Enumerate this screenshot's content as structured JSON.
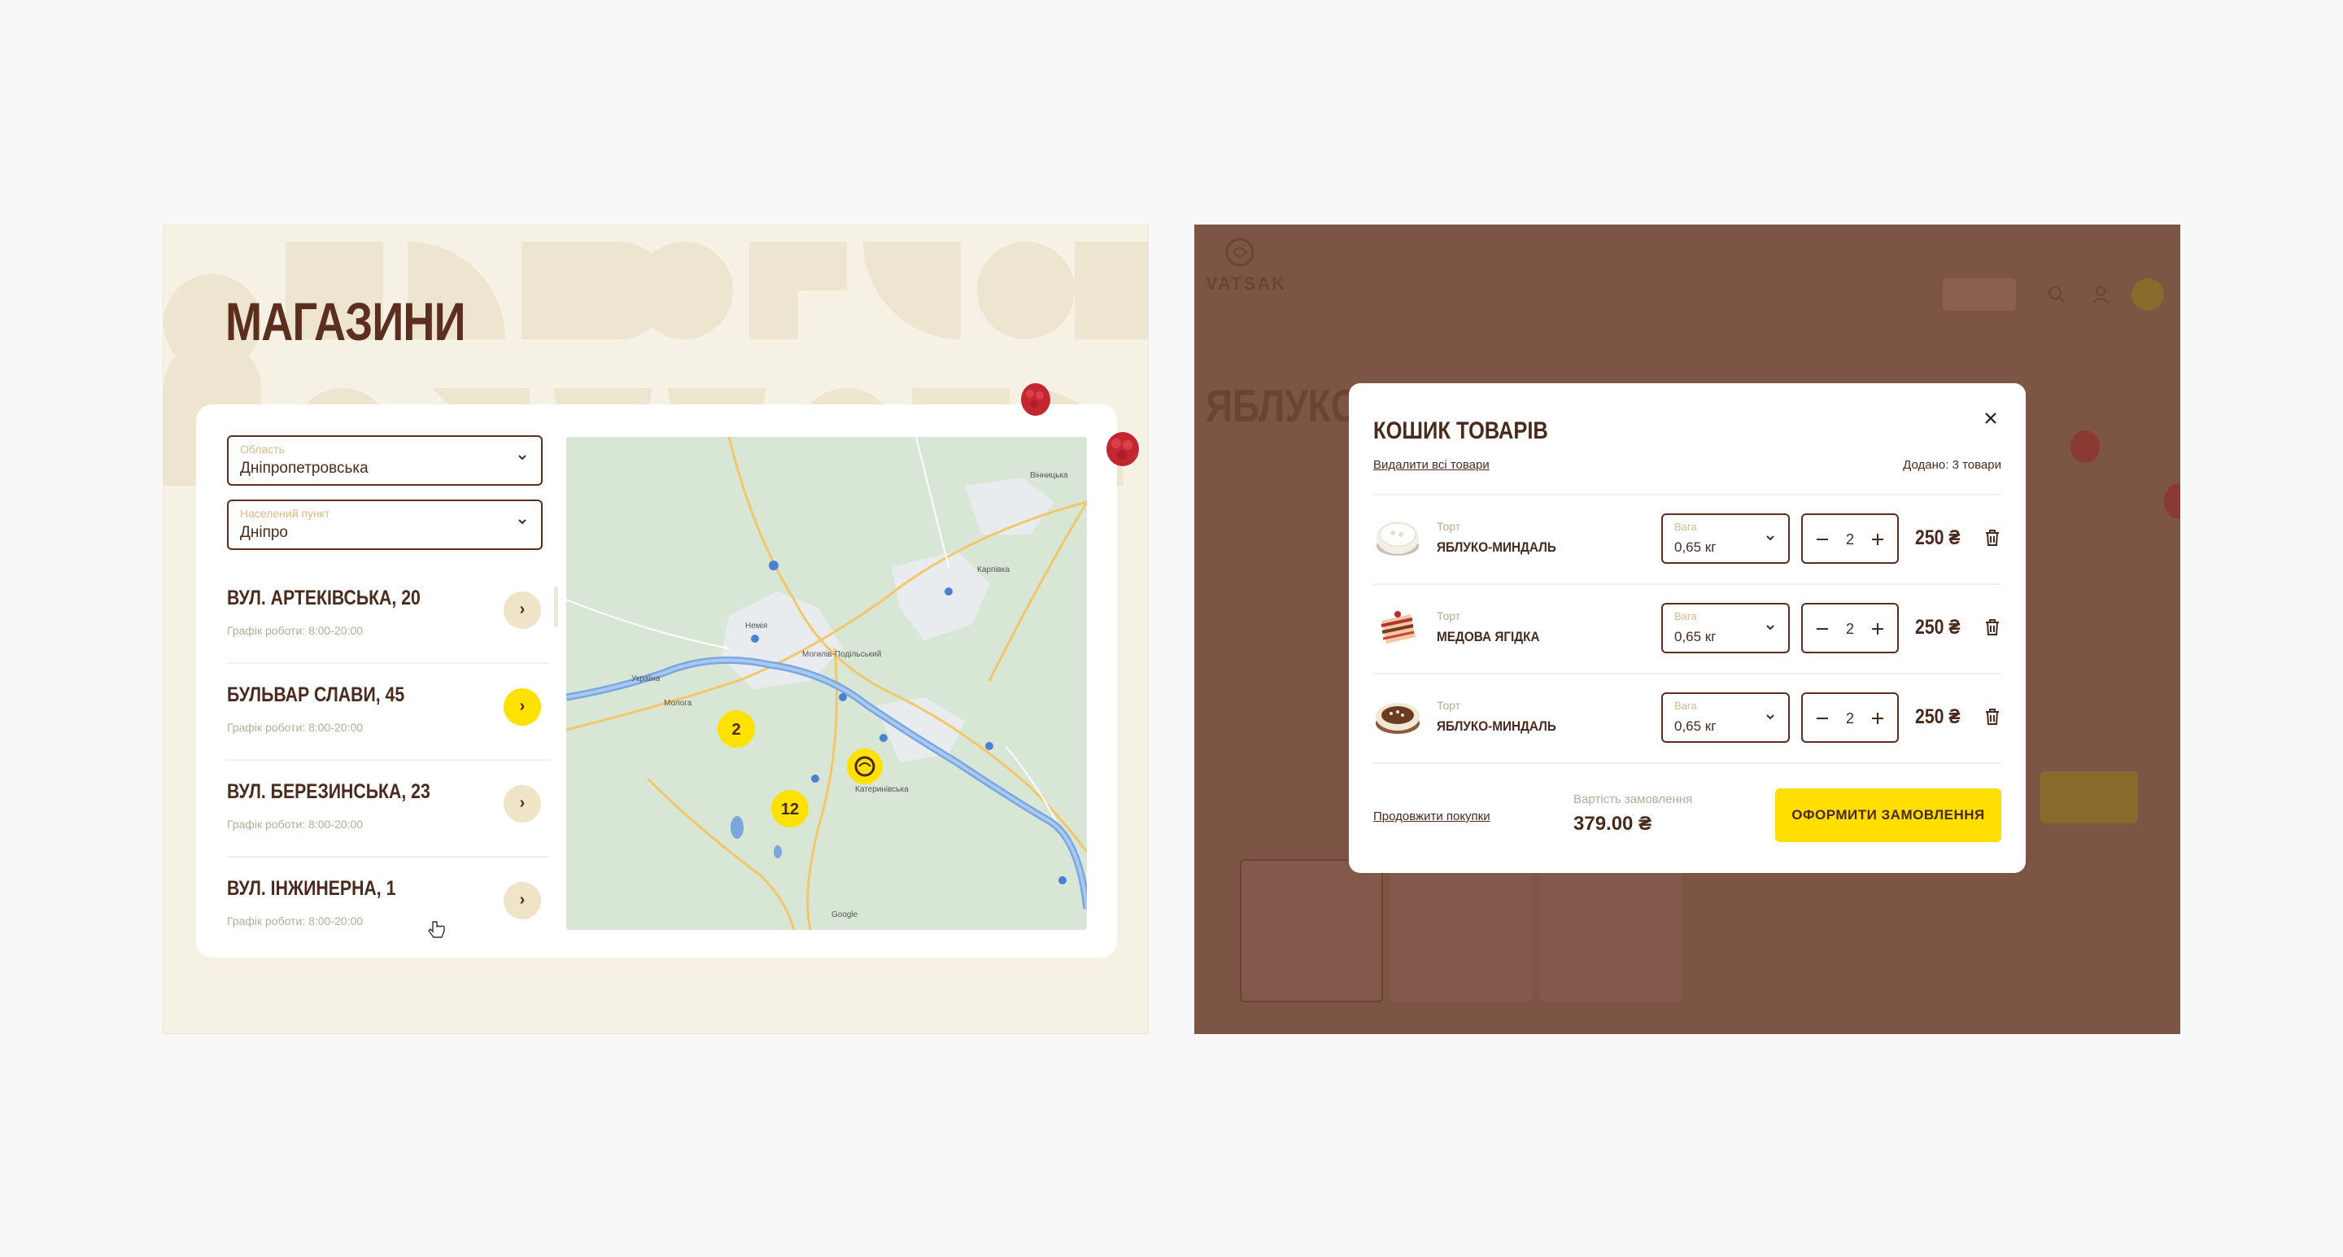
{
  "stores": {
    "title": "МАГАЗИНИ",
    "region": {
      "label": "Область",
      "value": "Дніпропетровська"
    },
    "city": {
      "label": "Населений пункт",
      "value": "Дніпро"
    },
    "items": [
      {
        "name": "ВУЛ. АРТЕКІВСЬКА, 20",
        "hours": "Графік роботи: 8:00-20:00",
        "arrow": "›"
      },
      {
        "name": "БУЛЬВАР СЛАВИ, 45",
        "hours": "Графік роботи: 8:00-20:00",
        "arrow": "›"
      },
      {
        "name": "ВУЛ. БЕРЕЗИНСЬКА, 23",
        "hours": "Графік роботи: 8:00-20:00",
        "arrow": "›"
      },
      {
        "name": "ВУЛ. ІНЖИНЕРНА, 1",
        "hours": "Графік роботи: 8:00-20:00",
        "arrow": "›"
      }
    ],
    "map": {
      "clusters": [
        "2",
        "12"
      ],
      "labels": [
        "Україна",
        "Молога",
        "Могилів-Подільський",
        "Немія",
        "Карпівка",
        "Вінницька",
        "Катеринівська",
        "Google"
      ]
    }
  },
  "background_page": {
    "logo": "VATSAK",
    "partial_title": "ЯБЛУКО"
  },
  "cart": {
    "title": "КОШИК ТОВАРІВ",
    "remove_all": "Видалити всі товари",
    "added": "Додано: 3 товари",
    "weight_label": "Вага",
    "items": [
      {
        "type": "Торт",
        "name": "ЯБЛУКО-МИНДАЛЬ",
        "weight": "0,65 кг",
        "qty": "2",
        "price": "250 ₴"
      },
      {
        "type": "Торт",
        "name": "МЕДОВА ЯГІДКА",
        "weight": "0,65 кг",
        "qty": "2",
        "price": "250 ₴"
      },
      {
        "type": "Торт",
        "name": "ЯБЛУКО-МИНДАЛЬ",
        "weight": "0,65 кг",
        "qty": "2",
        "price": "250 ₴"
      }
    ],
    "continue": "Продовжити покупки",
    "total_label": "Вартість замовлення",
    "total_value": "379.00 ₴",
    "checkout": "ОФОРМИТИ ЗАМОВЛЕННЯ"
  },
  "colors": {
    "brown": "#5b2e1e",
    "cream": "#f5f1e4",
    "yellow": "#ffde00",
    "overlay": "#7c5545"
  },
  "icons": [
    "chevron-down-icon",
    "arrow-right-icon",
    "close-icon",
    "minus-icon",
    "plus-icon",
    "trash-icon",
    "hand-cursor-icon",
    "map-pin-icon",
    "raspberry-icon"
  ]
}
